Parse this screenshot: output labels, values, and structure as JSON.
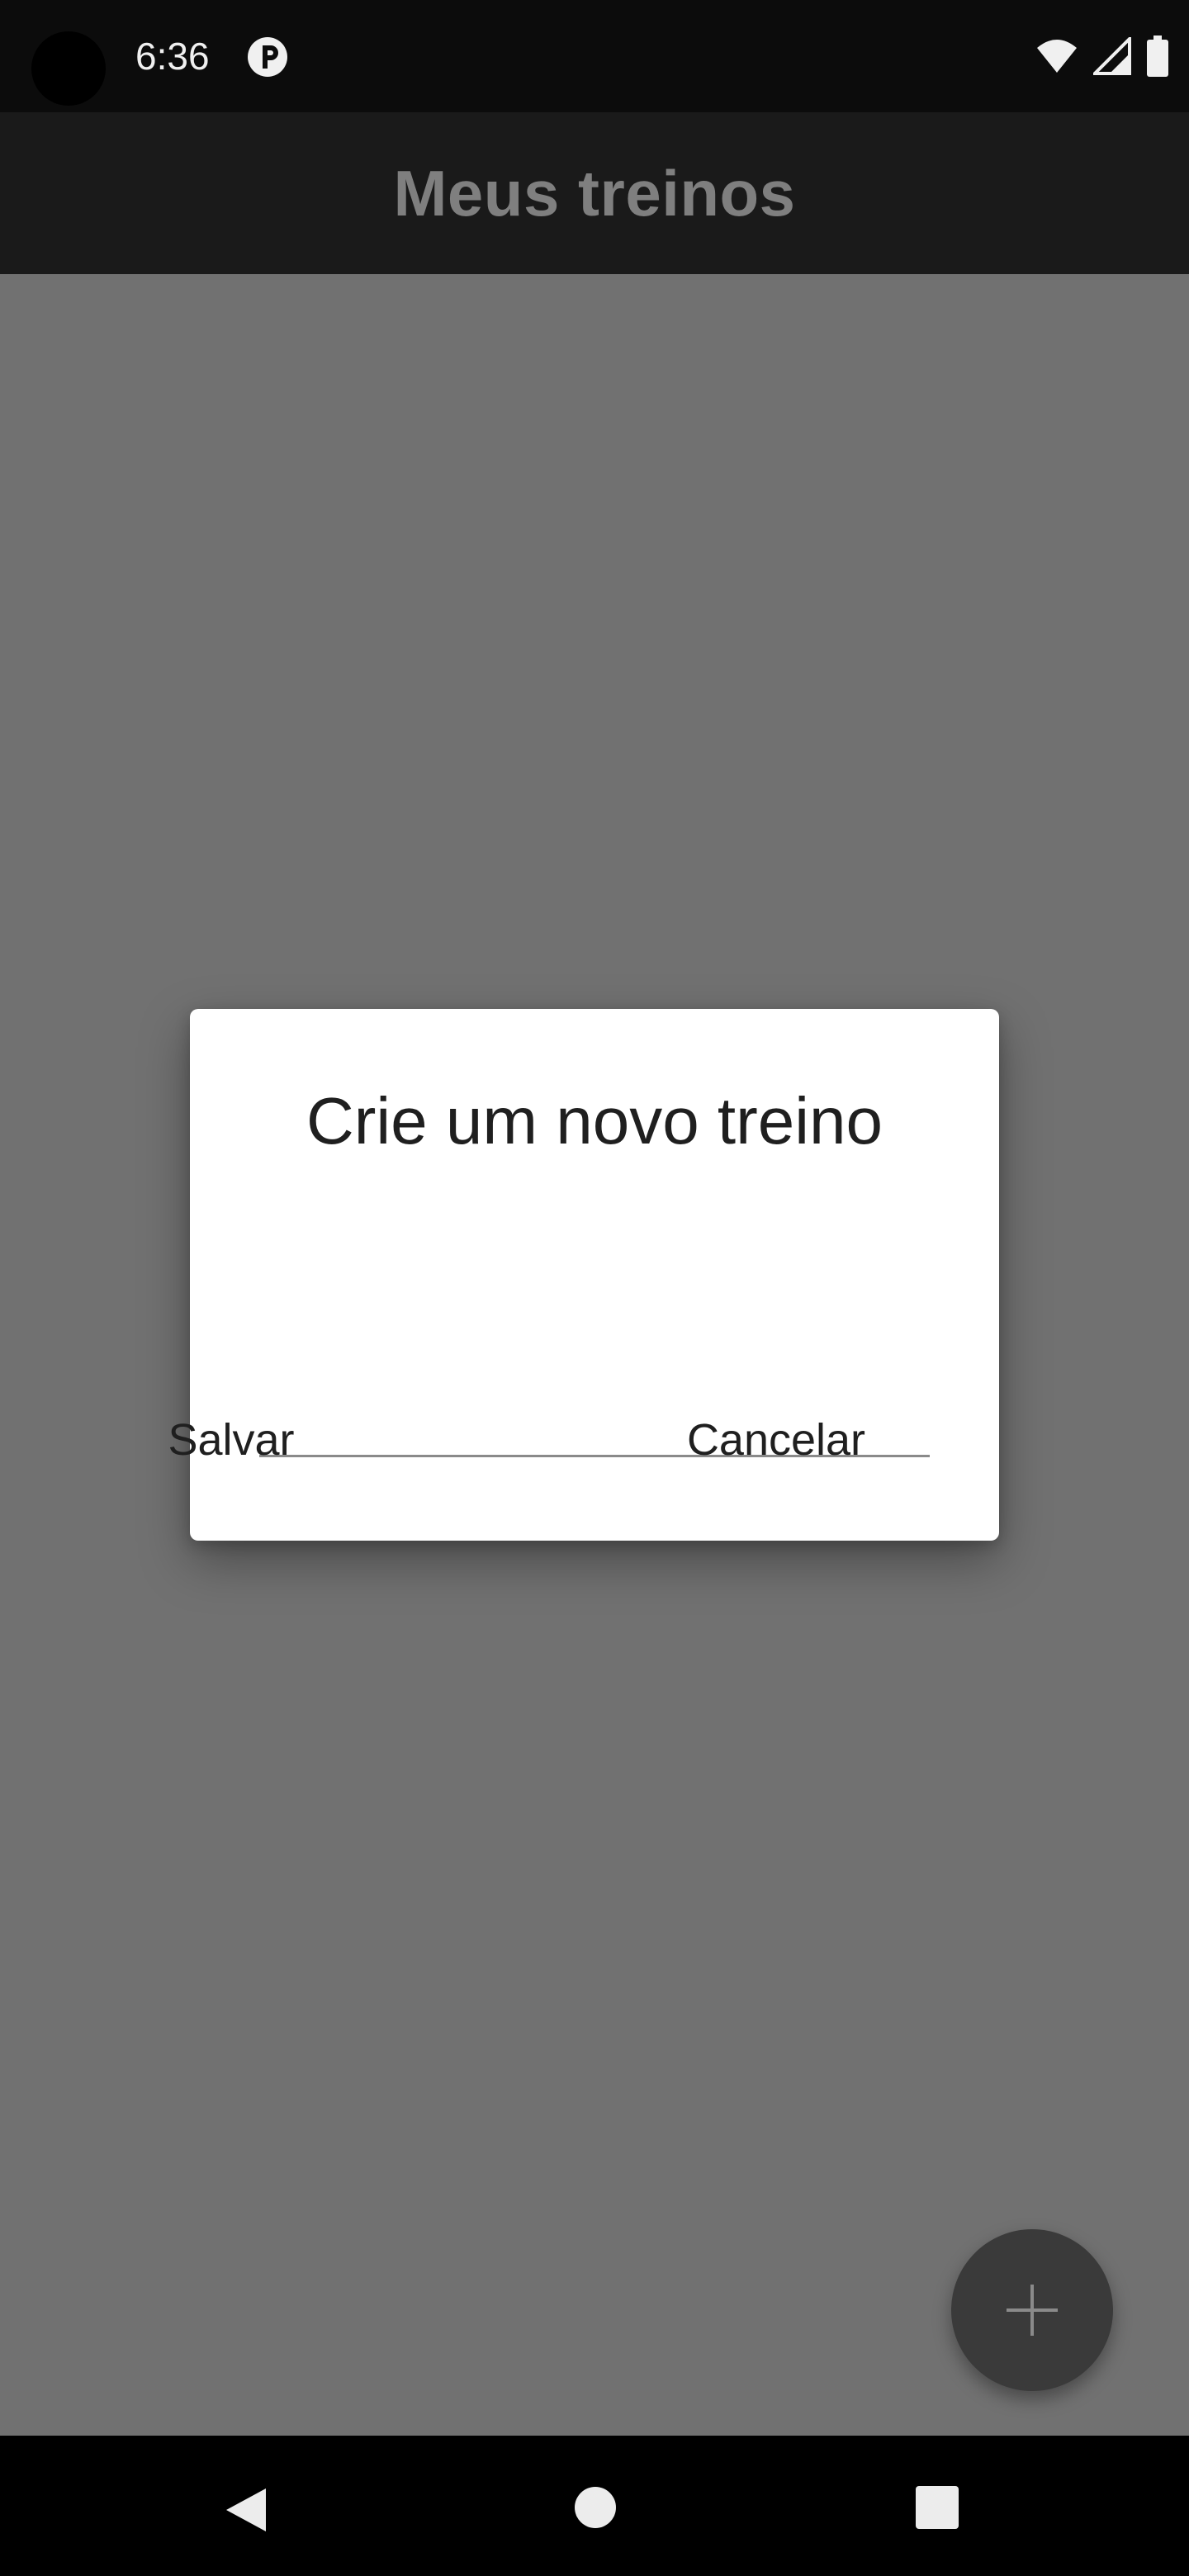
{
  "status_bar": {
    "time": "6:36",
    "icons": [
      "camera-cutout",
      "app-notification-icon",
      "wifi-icon",
      "signal-icon",
      "battery-icon"
    ]
  },
  "app_bar": {
    "title": "Meus treinos"
  },
  "dialog": {
    "title": "Crie um novo treino",
    "input_value": "",
    "input_placeholder": "",
    "save_label": "Salvar",
    "cancel_label": "Cancelar"
  },
  "fab": {
    "icon": "plus-icon"
  },
  "nav_bar": {
    "icons": [
      "back-icon",
      "home-icon",
      "recents-icon"
    ]
  },
  "colors": {
    "status_bar_bg": "#0c0c0c",
    "app_bar_bg": "#1a1a1a",
    "scrim_bg": "#717171",
    "dialog_bg": "#ffffff",
    "fab_bg": "#3a3a3a",
    "nav_bar_bg": "#000000"
  }
}
